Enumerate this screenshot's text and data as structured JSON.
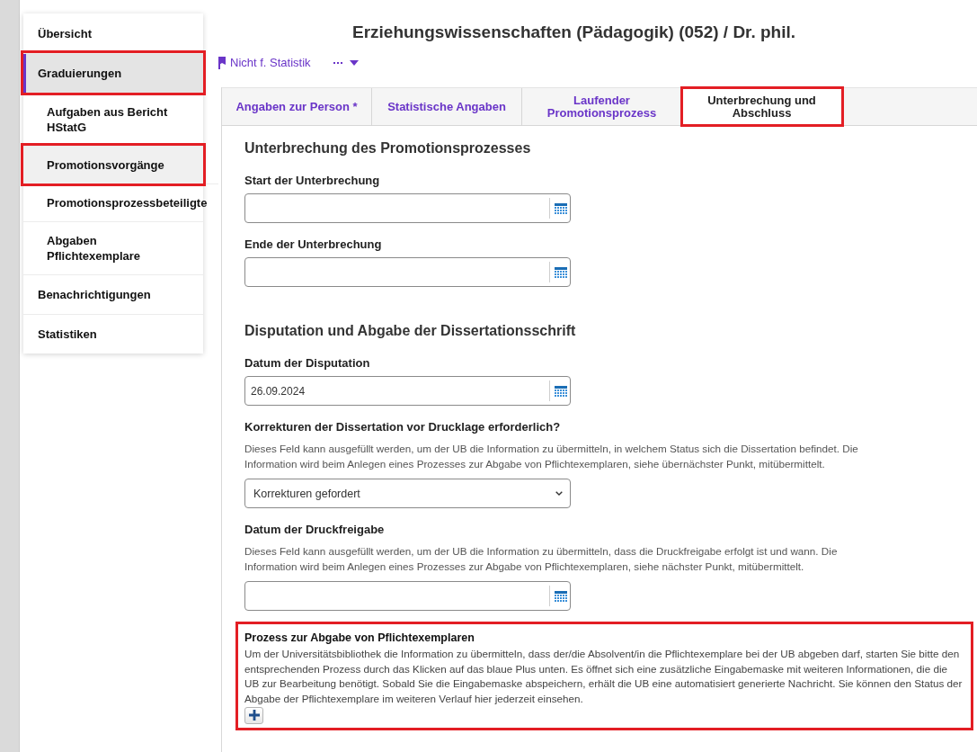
{
  "sidebar": {
    "items": [
      {
        "label": "Übersicht",
        "selected": false,
        "highlighted": false
      },
      {
        "label": "Graduierungen",
        "selected": true,
        "highlighted": true,
        "children": [
          {
            "label": "Aufgaben aus Bericht HStatG",
            "selected": false,
            "highlighted": false
          },
          {
            "label": "Promotionsvorgänge",
            "selected": true,
            "highlighted": true
          },
          {
            "label": "Promotionsprozessbeteiligte",
            "selected": false,
            "highlighted": false
          },
          {
            "label": "Abgaben Pflichtexemplare",
            "selected": false,
            "highlighted": false
          }
        ]
      },
      {
        "label": "Benachrichtigungen",
        "selected": false,
        "highlighted": false
      },
      {
        "label": "Statistiken",
        "selected": false,
        "highlighted": false
      }
    ]
  },
  "page": {
    "title": "Erziehungswissenschaften (Pädagogik) (052) / Dr. phil.",
    "toolbar": [
      {
        "kind": "flag",
        "label": "Nicht f. Statistik"
      },
      {
        "kind": "more"
      }
    ]
  },
  "tabs": [
    {
      "label": "Angaben zur Person *",
      "selected": false,
      "highlighted": false
    },
    {
      "label": "Statistische Angaben",
      "selected": false,
      "highlighted": false
    },
    {
      "label": "Laufender Promotionsprozess",
      "selected": false,
      "highlighted": false
    },
    {
      "label": "Unterbrechung und Abschluss",
      "selected": true,
      "highlighted": true
    }
  ],
  "sections": [
    {
      "heading": "Unterbrechung des Promotionsprozesses",
      "fields": [
        {
          "kind": "date",
          "label": "Start der Unterbrechung"
        },
        {
          "kind": "date",
          "label": "Ende der Unterbrechung"
        }
      ]
    },
    {
      "heading": "Disputation und Abgabe der Dissertationsschrift",
      "fields": [
        {
          "kind": "date",
          "label": "Datum der Disputation",
          "value": "26.09.2024"
        },
        {
          "kind": "select",
          "label": "Korrekturen der Dissertation vor Drucklage erforderlich?",
          "help": "Dieses Feld kann ausgefüllt werden, um der UB die Information zu übermitteln, in welchem Status sich die Dissertation befindet. Die Information wird beim Anlegen eines Prozesses zur Abgabe von Pflichtexemplaren, siehe übernächster Punkt, mitübermittelt.",
          "value": "Korrekturen gefordert"
        },
        {
          "kind": "date",
          "label": "Datum der Druckfreigabe",
          "help": "Dieses Feld kann ausgefüllt werden, um der UB die Information zu übermitteln, dass die Druckfreigabe erfolgt ist und wann. Die Information wird beim Anlegen eines Prozesses zur Abgabe von Pflichtexemplaren, siehe nächster Punkt, mitübermittelt."
        }
      ]
    }
  ],
  "process_box": {
    "title": "Prozess zur Abgabe von Pflichtexemplaren",
    "text": "Um der Universitätsbibliothek die Information zu übermitteln, dass der/die Absolvent/in die Pflichtexemplare bei der UB abgeben darf, starten Sie bitte den entsprechenden Prozess durch das Klicken auf das blaue Plus unten. Es öffnet sich eine zusätzliche Eingabemaske mit weiteren Informationen, die die UB zur Bearbeitung benötigt. Sobald Sie die Eingabemaske abspeichern, erhält die UB eine automatisiert generierte Nachricht. Sie können den Status der Abgabe der Pflichtexemplare im weiteren Verlauf hier jederzeit einsehen.",
    "highlighted": true
  }
}
